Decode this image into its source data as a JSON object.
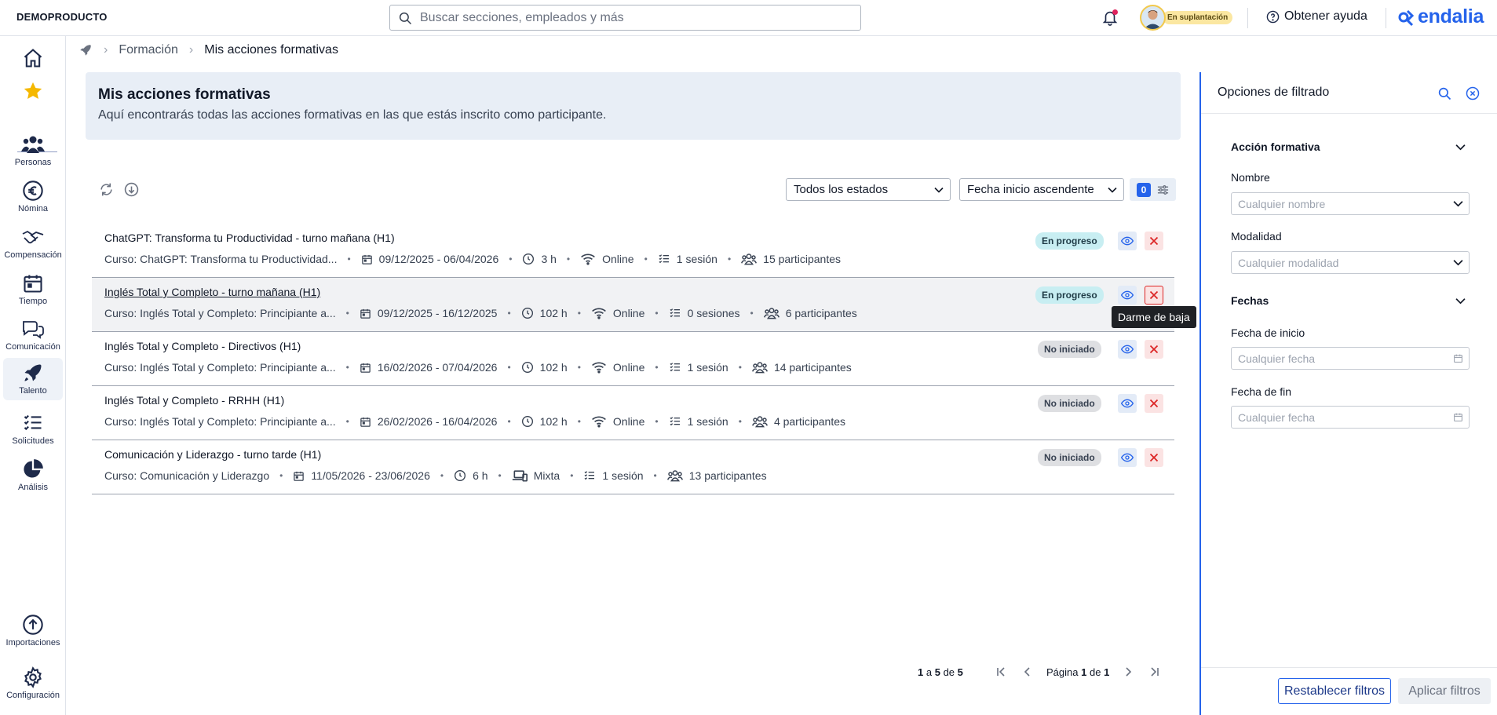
{
  "app": {
    "brand": "DEMOPRODUCTO",
    "logo_text": "endalia"
  },
  "search": {
    "placeholder": "Buscar secciones, empleados y más"
  },
  "user": {
    "status_badge": "En suplantación"
  },
  "help": {
    "label": "Obtener ayuda"
  },
  "sidebar": {
    "items": [
      {
        "label": "",
        "icon": "home-icon"
      },
      {
        "label": "",
        "icon": "star-icon"
      },
      {
        "label": "Personas",
        "icon": "people-icon"
      },
      {
        "label": "Nómina",
        "icon": "euro-icon"
      },
      {
        "label": "Compensación",
        "icon": "handshake-icon"
      },
      {
        "label": "Tiempo",
        "icon": "calendar-icon"
      },
      {
        "label": "Comunicación",
        "icon": "chat-icon"
      },
      {
        "label": "Talento",
        "icon": "rocket-icon"
      },
      {
        "label": "Solicitudes",
        "icon": "checklist-icon"
      },
      {
        "label": "Análisis",
        "icon": "pie-chart-icon"
      },
      {
        "label": "Importaciones",
        "icon": "upload-icon"
      },
      {
        "label": "Configuración",
        "icon": "gear-icon"
      }
    ]
  },
  "breadcrumb": {
    "section": "Formación",
    "current": "Mis acciones formativas"
  },
  "header": {
    "title": "Mis acciones formativas",
    "description": "Aquí encontrarás todas las acciones formativas en las que estás inscrito como participante."
  },
  "toolbar": {
    "status_filter": "Todos los estados",
    "sort": "Fecha inicio ascendente",
    "active_filters": "0"
  },
  "actions": [
    {
      "title": "ChatGPT: Transforma tu Productividad - turno mañana (H1)",
      "course": "Curso: ChatGPT: Transforma tu Productividad...",
      "dates": "09/12/2025 - 06/04/2026",
      "hours": "3 h",
      "mode": "Online",
      "sessions": "1 sesión",
      "participants": "15 participantes",
      "status": "En progreso"
    },
    {
      "title": "Inglés Total y Completo - turno mañana (H1)",
      "course": "Curso: Inglés Total y Completo: Principiante a...",
      "dates": "09/12/2025 - 16/12/2025",
      "hours": "102 h",
      "mode": "Online",
      "sessions": "0 sesiones",
      "participants": "6 participantes",
      "status": "En progreso"
    },
    {
      "title": "Inglés Total y Completo - Directivos (H1)",
      "course": "Curso: Inglés Total y Completo: Principiante a...",
      "dates": "16/02/2026 - 07/04/2026",
      "hours": "102 h",
      "mode": "Online",
      "sessions": "1 sesión",
      "participants": "14 participantes",
      "status": "No iniciado"
    },
    {
      "title": "Inglés Total y Completo - RRHH (H1)",
      "course": "Curso: Inglés Total y Completo: Principiante a...",
      "dates": "26/02/2026 - 16/04/2026",
      "hours": "102 h",
      "mode": "Online",
      "sessions": "1 sesión",
      "participants": "4 participantes",
      "status": "No iniciado"
    },
    {
      "title": "Comunicación y Liderazgo - turno tarde (H1)",
      "course": "Curso: Comunicación y Liderazgo",
      "dates": "11/05/2026 - 23/06/2026",
      "hours": "6 h",
      "mode": "Mixta",
      "sessions": "1 sesión",
      "participants": "13 participantes",
      "status": "No iniciado"
    }
  ],
  "tooltip": {
    "text": "Darme de baja"
  },
  "pagination": {
    "from": "1",
    "to": "5",
    "total": "5",
    "page": "1",
    "pages": "1",
    "word_a": "a",
    "word_de": "de",
    "word_pagina": "Página"
  },
  "filters": {
    "title": "Opciones de filtrado",
    "section_action": "Acción formativa",
    "name_label": "Nombre",
    "name_placeholder": "Cualquier nombre",
    "mode_label": "Modalidad",
    "mode_placeholder": "Cualquier modalidad",
    "section_dates": "Fechas",
    "start_label": "Fecha de inicio",
    "start_placeholder": "Cualquier fecha",
    "end_label": "Fecha de fin",
    "end_placeholder": "Cualquier fecha",
    "reset_button": "Restablecer filtros",
    "apply_button": "Aplicar filtros"
  },
  "colors": {
    "accent": "#2563eb",
    "nav": "#1e2a4a",
    "header_bg": "#e8eef6",
    "progress_badge": "#c8eef2",
    "not_started_badge": "#dedfe2",
    "delete": "#dc2626"
  }
}
